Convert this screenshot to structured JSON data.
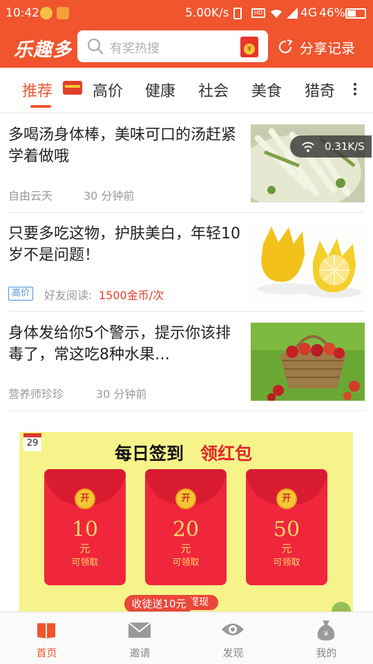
{
  "status": {
    "time": "10:42",
    "speed": "5.00K/s",
    "network": "4G",
    "battery": "46%"
  },
  "app": {
    "logo": "乐趣多",
    "search_placeholder": "有奖热搜",
    "share_label": "分享记录"
  },
  "tabs": [
    "推荐",
    "高价",
    "健康",
    "社会",
    "美食",
    "猎奇"
  ],
  "speed_overlay": "0.31K/S",
  "articles": [
    {
      "title": "多喝汤身体棒，美味可口的汤赶紧学着做哦",
      "author": "自由云天",
      "time": "30 分钟前"
    },
    {
      "title": "只要多吃这物，护肤美白，年轻10岁不是问题！",
      "badge": "高价",
      "reward_label": "好友阅读:",
      "reward_value": "1500金币/次"
    },
    {
      "title": "身体发给你5个警示，提示你该排毒了，常这吃8种水果…",
      "author": "营养师珍珍",
      "time": "30 分钟前"
    }
  ],
  "banner": {
    "calendar_day": "29",
    "title_a": "每日签到",
    "title_b": "领红包",
    "envelopes": [
      {
        "coin": "开",
        "amount": "10",
        "unit": "元",
        "caption": "可领取"
      },
      {
        "coin": "开",
        "amount": "20",
        "unit": "元",
        "caption": "可领取"
      },
      {
        "coin": "开",
        "amount": "50",
        "unit": "元",
        "caption": "可领取"
      }
    ],
    "bottom_text": "提现"
  },
  "invite_pill": "收徒送10元",
  "tabbar": [
    {
      "label": "首页"
    },
    {
      "label": "邀请"
    },
    {
      "label": "发现"
    },
    {
      "label": "我的"
    }
  ],
  "colors": {
    "brand": "#f0552e",
    "envelope": "#f0263c",
    "banner_bg": "#f6f38b",
    "reward": "#e0402a",
    "badge": "#4a90e2"
  }
}
